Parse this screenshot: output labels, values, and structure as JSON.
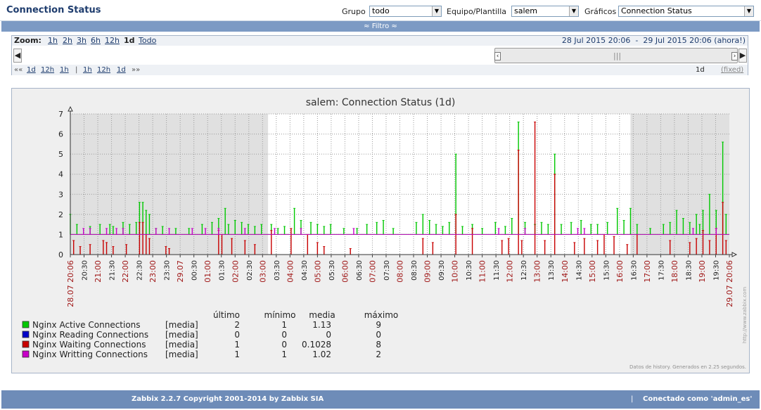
{
  "header": {
    "title": "Connection Status",
    "group_label": "Grupo",
    "group_value": "todo",
    "host_label": "Equipo/Plantilla",
    "host_value": "salem",
    "graph_label": "Gráficos",
    "graph_value": "Connection Status"
  },
  "filter_bar": {
    "label": "≈ Filtro ≈"
  },
  "zoom": {
    "label": "Zoom:",
    "options": [
      "1h",
      "2h",
      "3h",
      "6h",
      "12h",
      "1d",
      "Todo"
    ],
    "active": "1d",
    "period_from": "28 Jul 2015 20:06",
    "period_separator": "-",
    "period_to": "29 Jul 2015 20:06 (ahora!)"
  },
  "navigation": {
    "back": [
      "««",
      "1d",
      "12h",
      "1h"
    ],
    "separator": "|",
    "forward": [
      "1h",
      "12h",
      "1d",
      "»»"
    ],
    "period": "1d",
    "fixed_label": "(fixed)"
  },
  "graph": {
    "watermark": "http://www.zabbix.com",
    "generated_note": "Datos de history. Generados en 2.25 segundos."
  },
  "chart_data": {
    "type": "line",
    "title": "salem: Connection Status (1d)",
    "ylim": [
      0,
      7
    ],
    "y_ticks": [
      0,
      1,
      2,
      3,
      4,
      5,
      6,
      7
    ],
    "grid": true,
    "x_ticks": [
      "28.07 20:06",
      "20:30",
      "21:00",
      "21:30",
      "22:00",
      "22:30",
      "23:00",
      "23:30",
      "29.07",
      "00:30",
      "01:00",
      "01:30",
      "02:00",
      "02:30",
      "03:00",
      "03:30",
      "04:00",
      "04:30",
      "05:00",
      "05:30",
      "06:00",
      "06:30",
      "07:00",
      "07:30",
      "08:00",
      "08:30",
      "09:00",
      "09:30",
      "10:00",
      "10:30",
      "11:00",
      "11:30",
      "12:00",
      "12:30",
      "13:00",
      "13:30",
      "14:00",
      "14:30",
      "15:00",
      "15:30",
      "16:00",
      "16:30",
      "17:00",
      "17:30",
      "18:00",
      "18:30",
      "19:00",
      "19:30",
      "29.07 20:06"
    ],
    "red_ticks": [
      "28.07 20:06",
      "21:00",
      "22:00",
      "23:00",
      "29.07",
      "01:00",
      "02:00",
      "03:00",
      "04:00",
      "05:00",
      "06:00",
      "07:00",
      "08:00",
      "09:00",
      "10:00",
      "11:00",
      "12:00",
      "13:00",
      "14:00",
      "15:00",
      "16:00",
      "17:00",
      "18:00",
      "19:00",
      "29.07 20:06"
    ],
    "night_shading": [
      [
        0,
        0.6
      ],
      [
        1.0,
        1.0
      ]
    ],
    "legend_headers": [
      "último",
      "mínimo",
      "media",
      "máximo"
    ],
    "series": [
      {
        "name": "Nginx Active Connections",
        "func": "[media]",
        "color": "#00c800",
        "last": "2",
        "min": "1",
        "avg": "1.13",
        "max": "9",
        "baseline": 1,
        "spikes": [
          [
            0.0,
            2
          ],
          [
            0.02,
            1.5
          ],
          [
            0.06,
            1.4
          ],
          [
            0.09,
            1.5
          ],
          [
            0.12,
            1.5
          ],
          [
            0.13,
            1.4
          ],
          [
            0.16,
            1.6
          ],
          [
            0.18,
            1.5
          ],
          [
            0.2,
            1.6
          ],
          [
            0.21,
            2.6
          ],
          [
            0.22,
            2.6
          ],
          [
            0.23,
            2.2
          ],
          [
            0.24,
            2.0
          ],
          [
            0.26,
            1.3
          ],
          [
            0.28,
            1.4
          ],
          [
            0.32,
            1.3
          ],
          [
            0.36,
            1.3
          ],
          [
            0.4,
            1.5
          ],
          [
            0.43,
            1.6
          ],
          [
            0.45,
            1.8
          ],
          [
            0.47,
            2.3
          ],
          [
            0.48,
            1.5
          ],
          [
            0.5,
            1.7
          ],
          [
            0.52,
            1.6
          ],
          [
            0.54,
            1.5
          ],
          [
            0.56,
            1.4
          ],
          [
            0.58,
            1.5
          ],
          [
            0.61,
            1.5
          ],
          [
            0.63,
            1.3
          ],
          [
            0.65,
            1.4
          ],
          [
            0.68,
            2.3
          ],
          [
            0.7,
            1.7
          ],
          [
            0.73,
            1.6
          ],
          [
            0.75,
            1.5
          ],
          [
            0.77,
            1.4
          ],
          [
            0.79,
            1.5
          ],
          [
            0.83,
            1.3
          ],
          [
            0.87,
            1.3
          ],
          [
            0.9,
            1.5
          ],
          [
            0.93,
            1.6
          ],
          [
            0.95,
            1.7
          ],
          [
            0.98,
            1.3
          ],
          [
            1.05,
            1.6
          ],
          [
            1.07,
            2.0
          ],
          [
            1.09,
            1.7
          ],
          [
            1.11,
            1.5
          ],
          [
            1.13,
            1.4
          ],
          [
            1.15,
            1.6
          ],
          [
            1.17,
            5.0
          ],
          [
            1.19,
            1.4
          ],
          [
            1.22,
            1.5
          ],
          [
            1.25,
            1.3
          ],
          [
            1.29,
            1.6
          ],
          [
            1.32,
            1.4
          ],
          [
            1.34,
            1.8
          ],
          [
            1.36,
            6.6
          ],
          [
            1.38,
            1.6
          ],
          [
            1.41,
            1.5
          ],
          [
            1.43,
            1.6
          ],
          [
            1.45,
            1.5
          ],
          [
            1.47,
            5.0
          ],
          [
            1.49,
            1.5
          ],
          [
            1.52,
            1.6
          ],
          [
            1.55,
            1.7
          ],
          [
            1.58,
            1.5
          ],
          [
            1.6,
            1.5
          ],
          [
            1.63,
            1.6
          ],
          [
            1.66,
            2.3
          ],
          [
            1.68,
            1.7
          ],
          [
            1.7,
            2.3
          ],
          [
            1.72,
            1.5
          ],
          [
            1.76,
            1.3
          ],
          [
            1.8,
            1.5
          ],
          [
            1.82,
            1.6
          ],
          [
            1.84,
            2.2
          ],
          [
            1.86,
            1.8
          ],
          [
            1.88,
            1.6
          ],
          [
            1.9,
            2.0
          ],
          [
            1.91,
            1.5
          ],
          [
            1.92,
            2.2
          ],
          [
            1.94,
            3.0
          ],
          [
            1.96,
            2.2
          ],
          [
            1.98,
            5.6
          ],
          [
            1.99,
            2.0
          ]
        ]
      },
      {
        "name": "Nginx Reading Connections",
        "func": "[media]",
        "color": "#0000c8",
        "last": "0",
        "min": "0",
        "avg": "0",
        "max": "0",
        "baseline": 0,
        "spikes": []
      },
      {
        "name": "Nginx Waiting Connections",
        "func": "[media]",
        "color": "#c80000",
        "last": "1",
        "min": "0",
        "avg": "0.1028",
        "max": "8",
        "baseline": 0,
        "spikes": [
          [
            0.01,
            0.7
          ],
          [
            0.03,
            0.4
          ],
          [
            0.06,
            0.5
          ],
          [
            0.1,
            0.7
          ],
          [
            0.11,
            0.6
          ],
          [
            0.13,
            0.4
          ],
          [
            0.17,
            0.5
          ],
          [
            0.21,
            1.6
          ],
          [
            0.22,
            1.6
          ],
          [
            0.23,
            1.0
          ],
          [
            0.24,
            0.8
          ],
          [
            0.29,
            0.4
          ],
          [
            0.3,
            0.3
          ],
          [
            0.45,
            1.2
          ],
          [
            0.46,
            1.0
          ],
          [
            0.49,
            0.8
          ],
          [
            0.53,
            0.7
          ],
          [
            0.56,
            0.5
          ],
          [
            0.61,
            1.2
          ],
          [
            0.67,
            1.3
          ],
          [
            0.72,
            1.0
          ],
          [
            0.75,
            0.6
          ],
          [
            0.77,
            0.4
          ],
          [
            0.85,
            0.3
          ],
          [
            1.07,
            0.8
          ],
          [
            1.1,
            0.6
          ],
          [
            1.17,
            2.0
          ],
          [
            1.22,
            1.3
          ],
          [
            1.31,
            0.7
          ],
          [
            1.33,
            0.8
          ],
          [
            1.36,
            5.2
          ],
          [
            1.37,
            0.7
          ],
          [
            1.41,
            6.6
          ],
          [
            1.44,
            0.7
          ],
          [
            1.47,
            4.0
          ],
          [
            1.53,
            0.6
          ],
          [
            1.56,
            0.8
          ],
          [
            1.6,
            0.7
          ],
          [
            1.62,
            1.0
          ],
          [
            1.65,
            0.9
          ],
          [
            1.69,
            0.5
          ],
          [
            1.72,
            1.0
          ],
          [
            1.82,
            0.7
          ],
          [
            1.88,
            0.6
          ],
          [
            1.9,
            0.8
          ],
          [
            1.92,
            1.2
          ],
          [
            1.94,
            0.7
          ],
          [
            1.96,
            1.3
          ],
          [
            1.98,
            2.6
          ],
          [
            1.99,
            0.7
          ]
        ]
      },
      {
        "name": "Nginx Writting Connections",
        "func": "[media]",
        "color": "#c800c8",
        "last": "1",
        "min": "1",
        "avg": "1.02",
        "max": "2",
        "baseline": 1,
        "spikes": [
          [
            0.04,
            1.3
          ],
          [
            0.06,
            1.3
          ],
          [
            0.11,
            1.3
          ],
          [
            0.14,
            1.3
          ],
          [
            0.16,
            1.3
          ],
          [
            0.26,
            1.3
          ],
          [
            0.3,
            1.3
          ],
          [
            0.37,
            1.3
          ],
          [
            0.41,
            1.3
          ],
          [
            0.45,
            1.3
          ],
          [
            0.53,
            1.3
          ],
          [
            0.62,
            1.3
          ],
          [
            0.7,
            1.3
          ],
          [
            0.86,
            1.3
          ],
          [
            1.3,
            1.3
          ],
          [
            1.38,
            1.3
          ],
          [
            1.54,
            1.3
          ],
          [
            1.56,
            1.3
          ],
          [
            1.89,
            1.3
          ],
          [
            1.96,
            1.3
          ]
        ]
      }
    ]
  },
  "footer": {
    "copyright": "Zabbix 2.2.7 Copyright 2001-2014 by Zabbix SIA",
    "separator": "|",
    "connected_as": "Conectado como 'admin_es'"
  }
}
